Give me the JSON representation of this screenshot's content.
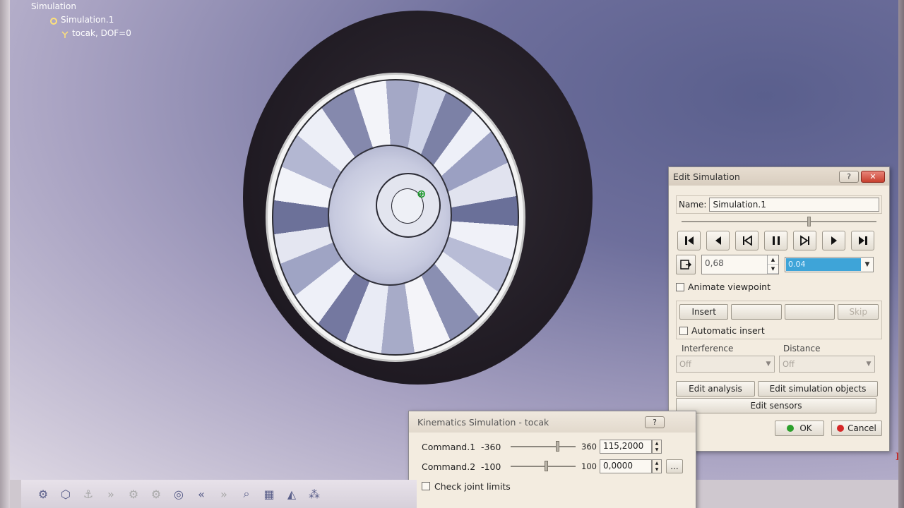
{
  "tree": {
    "root": "Simulation",
    "child": "Simulation.1",
    "leaf": "tocak, DOF=0"
  },
  "edit_simulation": {
    "title": "Edit Simulation",
    "help_label": "?",
    "close_label": "✕",
    "name_label": "Name:",
    "name_value": "Simulation.1",
    "player_buttons": [
      "first-icon",
      "play-back-icon",
      "step-back-icon",
      "pause-icon",
      "step-forward-icon",
      "play-icon",
      "last-icon"
    ],
    "step_value": "0,68",
    "step_size": "0.04",
    "animate_viewpoint": "Animate viewpoint",
    "insert_label": "Insert",
    "skip_label": "Skip",
    "automatic_insert": "Automatic insert",
    "interference_label": "Interference",
    "interference_value": "Off",
    "distance_label": "Distance",
    "distance_value": "Off",
    "edit_analysis": "Edit analysis",
    "edit_simulation_objects": "Edit simulation objects",
    "edit_sensors": "Edit sensors",
    "ok_label": "OK",
    "cancel_label": "Cancel",
    "colors": {
      "ok_dot": "#2ca02c",
      "cancel_dot": "#d62728",
      "selected": "#3ea4d8"
    }
  },
  "kinematics_simulation": {
    "title": "Kinematics Simulation - tocak",
    "help_label": "?",
    "commands": [
      {
        "label": "Command.1",
        "min": "-360",
        "max": "360",
        "value": "115,2000",
        "position": 0.66
      },
      {
        "label": "Command.2",
        "min": "-100",
        "max": "100",
        "value": "0,0000",
        "position": 0.5
      }
    ],
    "more_label": "...",
    "check_joint_limits": "Check joint limits"
  }
}
